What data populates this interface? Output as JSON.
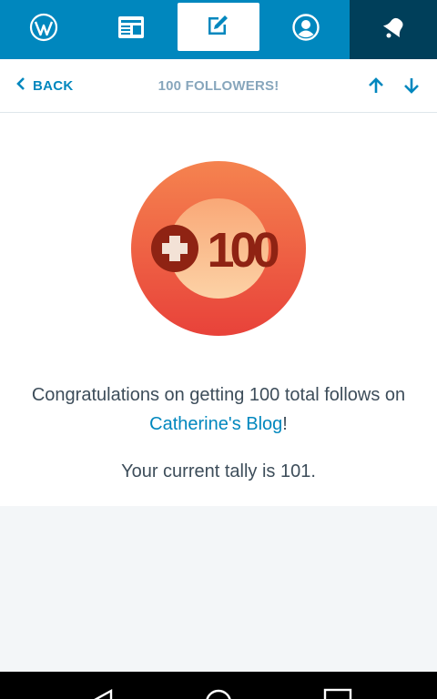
{
  "topbar": {
    "tabs": [
      {
        "icon": "wordpress-icon"
      },
      {
        "icon": "reader-icon"
      },
      {
        "icon": "write-post-icon"
      },
      {
        "icon": "me-icon"
      },
      {
        "icon": "notifications-icon"
      }
    ],
    "accent": "#0087be",
    "active_dark": "#003f5a"
  },
  "header": {
    "back_label": "BACK",
    "title": "100 FOLLOWERS!"
  },
  "notification": {
    "badge_text": "100",
    "message_prefix": "Congratulations on getting 100 total follows on ",
    "blog_link": "Catherine's Blog",
    "message_suffix": "!",
    "tally": "Your current tally is 101."
  },
  "system_nav": {
    "buttons": [
      "back-icon",
      "home-icon",
      "recents-icon"
    ]
  }
}
